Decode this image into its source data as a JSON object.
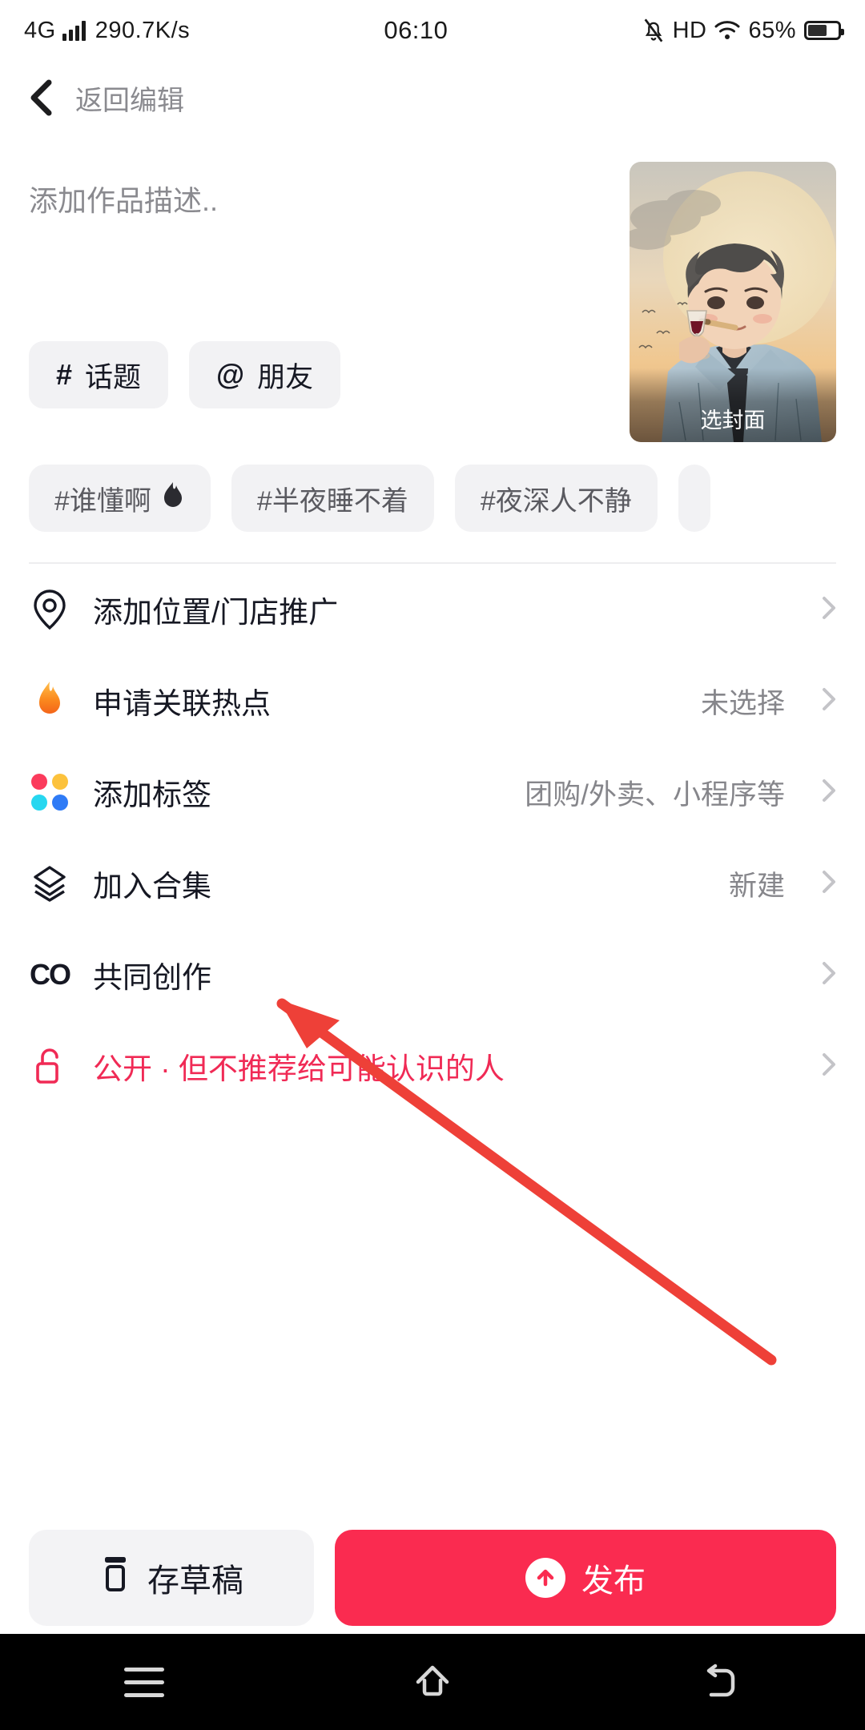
{
  "statusbar": {
    "network": "4G",
    "speed": "290.7K/s",
    "time": "06:10",
    "hd": "HD",
    "battery_percent": "65%",
    "icons": [
      "signal-bars-icon",
      "mute-icon",
      "hd-icon",
      "wifi-icon",
      "battery-icon"
    ]
  },
  "navbar": {
    "back_label": "返回编辑"
  },
  "composer": {
    "description_placeholder": "添加作品描述..",
    "description_value": "",
    "chips": [
      {
        "symbol": "#",
        "label": "话题",
        "name": "topic-chip"
      },
      {
        "symbol": "@",
        "label": "朋友",
        "name": "friend-chip"
      }
    ],
    "cover": {
      "label": "选封面",
      "alt": "anime boy with wine glass illustration"
    }
  },
  "suggested_tags": [
    {
      "label": "#谁懂啊",
      "emoji": "🔥"
    },
    {
      "label": "#半夜睡不着",
      "emoji": ""
    },
    {
      "label": "#夜深人不静",
      "emoji": ""
    },
    {
      "label": "",
      "emoji": ""
    }
  ],
  "settings": [
    {
      "icon": "location-pin-icon",
      "label": "添加位置/门店推广",
      "value": "",
      "name": "row-location"
    },
    {
      "icon": "flame-icon",
      "label": "申请关联热点",
      "value": "未选择",
      "name": "row-hotspot"
    },
    {
      "icon": "four-dots-icon",
      "label": "添加标签",
      "value": "团购/外卖、小程序等",
      "name": "row-add-tag"
    },
    {
      "icon": "layers-icon",
      "label": "加入合集",
      "value": "新建",
      "name": "row-collection"
    },
    {
      "icon": "co-create-icon",
      "label": "共同创作",
      "value": "",
      "name": "row-cocreate"
    },
    {
      "icon": "unlock-icon",
      "label": "公开 · 但不推荐给可能认识的人",
      "value": "",
      "name": "row-privacy"
    }
  ],
  "actions": {
    "draft_label": "存草稿",
    "publish_label": "发布"
  },
  "androidnav": {
    "items": [
      "recents-icon",
      "home-icon",
      "back-icon"
    ]
  },
  "colors": {
    "accent_red": "#fa2b50",
    "privacy_pink": "#f02a55",
    "chip_bg": "#f2f2f4",
    "muted_text": "#86868b",
    "annotation_arrow": "#ee4038"
  }
}
